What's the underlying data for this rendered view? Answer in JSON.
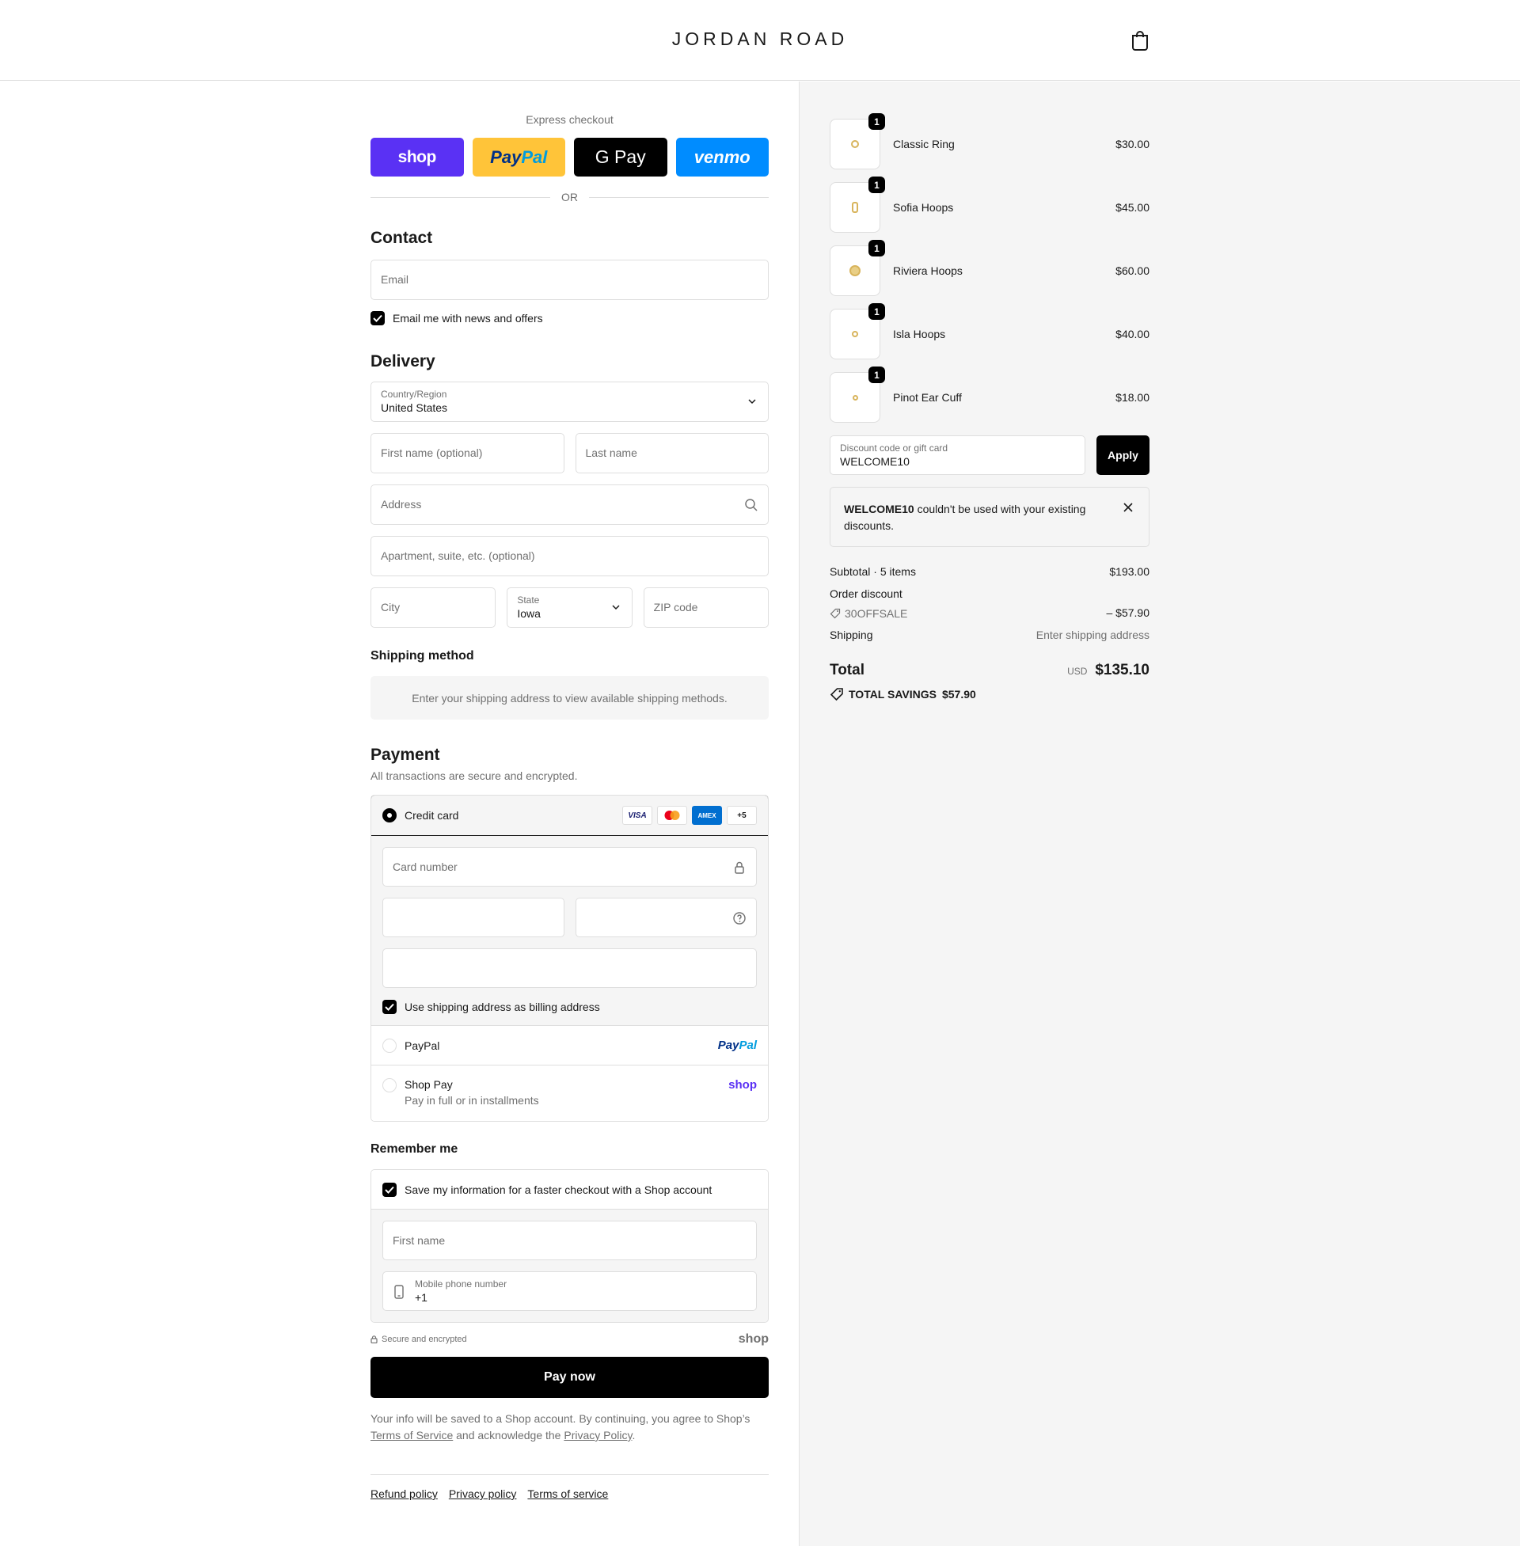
{
  "header": {
    "logo": "JORDAN ROAD"
  },
  "express": {
    "label": "Express checkout",
    "buttons": [
      "shop",
      "PayPal",
      "G Pay",
      "venmo"
    ],
    "or": "OR"
  },
  "contact": {
    "heading": "Contact",
    "email_placeholder": "Email",
    "news_label": "Email me with news and offers"
  },
  "delivery": {
    "heading": "Delivery",
    "country_label": "Country/Region",
    "country_value": "United States",
    "first_name": "First name (optional)",
    "last_name": "Last name",
    "address": "Address",
    "apartment": "Apartment, suite, etc. (optional)",
    "city": "City",
    "state_label": "State",
    "state_value": "Iowa",
    "zip": "ZIP code"
  },
  "shipping": {
    "heading": "Shipping method",
    "message": "Enter your shipping address to view available shipping methods."
  },
  "payment": {
    "heading": "Payment",
    "subtitle": "All transactions are secure and encrypted.",
    "credit_card": "Credit card",
    "card_logos": [
      "VISA",
      "MC",
      "AMEX",
      "+5"
    ],
    "card_number": "Card number",
    "billing_label": "Use shipping address as billing address",
    "paypal": "PayPal",
    "paypal_logo_a": "Pay",
    "paypal_logo_b": "Pal",
    "shop_pay": "Shop Pay",
    "shop_pay_sub": "Pay in full or in installments",
    "shop_logo": "shop"
  },
  "remember": {
    "heading": "Remember me",
    "save_label": "Save my information for a faster checkout with a Shop account",
    "first_name": "First name",
    "phone_label": "Mobile phone number",
    "phone_value": "+1"
  },
  "secure": {
    "label": "Secure and encrypted",
    "shop": "shop"
  },
  "pay_now": "Pay now",
  "legal": {
    "text_a": "Your info will be saved to a Shop account. By continuing, you agree to Shop’s",
    "tos": "Terms of Service",
    "text_b": " and acknowledge the ",
    "privacy": "Privacy Policy",
    "text_c": "."
  },
  "footer": {
    "links": [
      "Refund policy",
      "Privacy policy",
      "Terms of service"
    ]
  },
  "summary": {
    "items": [
      {
        "name": "Classic Ring",
        "qty": "1",
        "price": "$30.00"
      },
      {
        "name": "Sofia Hoops",
        "qty": "1",
        "price": "$45.00"
      },
      {
        "name": "Riviera Hoops",
        "qty": "1",
        "price": "$60.00"
      },
      {
        "name": "Isla Hoops",
        "qty": "1",
        "price": "$40.00"
      },
      {
        "name": "Pinot Ear Cuff",
        "qty": "1",
        "price": "$18.00"
      }
    ],
    "discount_label": "Discount code or gift card",
    "discount_value": "WELCOME10",
    "apply": "Apply",
    "notice_code": "WELCOME10",
    "notice_text": " couldn't be used with your existing discounts.",
    "subtotal_label": "Subtotal · 5 items",
    "subtotal_value": "$193.00",
    "order_discount_label": "Order discount",
    "discount_code": "30OFFSALE",
    "discount_amount": "– $57.90",
    "shipping_label": "Shipping",
    "shipping_value": "Enter shipping address",
    "total_label": "Total",
    "currency": "USD",
    "total_value": "$135.10",
    "savings_label": "TOTAL SAVINGS",
    "savings_value": "$57.90"
  },
  "colors": {
    "shop_purple": "#5a31f4",
    "paypal_yellow": "#ffc439",
    "venmo_blue": "#008cff",
    "summary_bg": "#f5f5f5"
  }
}
